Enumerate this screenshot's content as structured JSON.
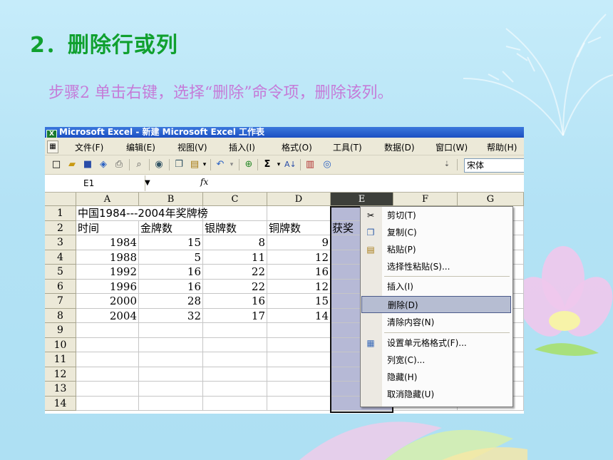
{
  "slide": {
    "title": "2．删除行或列",
    "step": "步骤2  单击右键，选择“删除”命令项，删除该列。"
  },
  "colors": {
    "title": "#10a02f",
    "step": "#c57bd8",
    "menu_highlight": "#b6bdd2",
    "selected_column": "#b6b9d6"
  },
  "excel": {
    "window_title": "Microsoft Excel - 新建 Microsoft Excel 工作表",
    "menu": [
      "文件(F)",
      "编辑(E)",
      "视图(V)",
      "插入(I)",
      "格式(O)",
      "工具(T)",
      "数据(D)",
      "窗口(W)",
      "帮助(H)"
    ],
    "toolbar_icons": [
      "new-icon",
      "open-icon",
      "save-icon",
      "permission-icon",
      "print-icon",
      "print-preview-icon",
      "research-icon",
      "copy-icon",
      "paste-icon",
      "undo-icon",
      "hyperlink-icon",
      "autosum-icon",
      "sort-ascending-icon",
      "chart-icon",
      "help-icon"
    ],
    "font_name": "宋体",
    "name_box": "E1",
    "fx_label": "fx",
    "columns": [
      "A",
      "B",
      "C",
      "D",
      "E",
      "F",
      "G"
    ],
    "rows": [
      "1",
      "2",
      "3",
      "4",
      "5",
      "6",
      "7",
      "8",
      "9",
      "10",
      "11",
      "12",
      "13",
      "14"
    ],
    "cells": {
      "A1": "中国1984---2004年奖牌榜",
      "A2": "时间",
      "B2": "金牌数",
      "C2": "银牌数",
      "D2": "铜牌数",
      "E2": "获奖",
      "data": [
        [
          "1984",
          "15",
          "8",
          "9"
        ],
        [
          "1988",
          "5",
          "11",
          "12"
        ],
        [
          "1992",
          "16",
          "22",
          "16"
        ],
        [
          "1996",
          "16",
          "22",
          "12"
        ],
        [
          "2000",
          "28",
          "16",
          "15"
        ],
        [
          "2004",
          "32",
          "17",
          "14"
        ]
      ]
    },
    "selected_column": "E"
  },
  "context_menu": {
    "items": [
      {
        "label": "剪切(T)",
        "icon": "scissors-icon"
      },
      {
        "label": "复制(C)",
        "icon": "copy-icon"
      },
      {
        "label": "粘贴(P)",
        "icon": "paste-icon"
      },
      {
        "label": "选择性粘贴(S)...",
        "icon": ""
      },
      {
        "label": "插入(I)",
        "icon": ""
      },
      {
        "label": "删除(D)",
        "icon": "",
        "highlighted": true
      },
      {
        "label": "清除内容(N)",
        "icon": ""
      },
      {
        "label": "设置单元格格式(F)...",
        "icon": "format-cells-icon"
      },
      {
        "label": "列宽(C)...",
        "icon": ""
      },
      {
        "label": "隐藏(H)",
        "icon": ""
      },
      {
        "label": "取消隐藏(U)",
        "icon": ""
      }
    ]
  }
}
